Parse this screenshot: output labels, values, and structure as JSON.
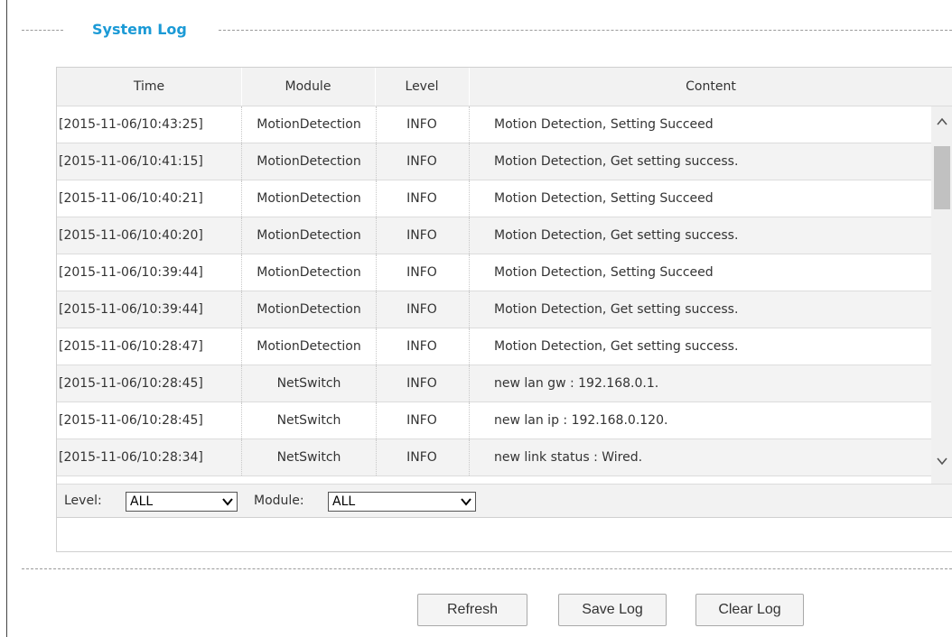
{
  "section": {
    "title": "System Log"
  },
  "table": {
    "columns": [
      "Time",
      "Module",
      "Level",
      "Content"
    ],
    "rows": [
      {
        "time": "[2015-11-06/10:43:25]",
        "module": "MotionDetection",
        "level": "INFO",
        "content": "Motion Detection, Setting Succeed"
      },
      {
        "time": "[2015-11-06/10:41:15]",
        "module": "MotionDetection",
        "level": "INFO",
        "content": "Motion Detection, Get setting success."
      },
      {
        "time": "[2015-11-06/10:40:21]",
        "module": "MotionDetection",
        "level": "INFO",
        "content": "Motion Detection, Setting Succeed"
      },
      {
        "time": "[2015-11-06/10:40:20]",
        "module": "MotionDetection",
        "level": "INFO",
        "content": "Motion Detection, Get setting success."
      },
      {
        "time": "[2015-11-06/10:39:44]",
        "module": "MotionDetection",
        "level": "INFO",
        "content": "Motion Detection, Setting Succeed"
      },
      {
        "time": "[2015-11-06/10:39:44]",
        "module": "MotionDetection",
        "level": "INFO",
        "content": "Motion Detection, Get setting success."
      },
      {
        "time": "[2015-11-06/10:28:47]",
        "module": "MotionDetection",
        "level": "INFO",
        "content": "Motion Detection, Get setting success."
      },
      {
        "time": "[2015-11-06/10:28:45]",
        "module": "NetSwitch",
        "level": "INFO",
        "content": "new lan gw : 192.168.0.1."
      },
      {
        "time": "[2015-11-06/10:28:45]",
        "module": "NetSwitch",
        "level": "INFO",
        "content": "new lan ip : 192.168.0.120."
      },
      {
        "time": "[2015-11-06/10:28:34]",
        "module": "NetSwitch",
        "level": "INFO",
        "content": "new link status : Wired."
      }
    ]
  },
  "filters": {
    "level_label": "Level:",
    "level_value": "ALL",
    "module_label": "Module:",
    "module_value": "ALL"
  },
  "icons": {
    "scroll_up": "chevron-up-icon",
    "scroll_down": "chevron-down-icon",
    "dropdown": "chevron-down-icon"
  },
  "buttons": {
    "refresh": "Refresh",
    "save_log": "Save Log",
    "clear_log": "Clear Log"
  },
  "colors": {
    "title": "#1b9ad6",
    "header_bg": "#f2f2f2",
    "row_alt_bg": "#f3f3f3"
  }
}
